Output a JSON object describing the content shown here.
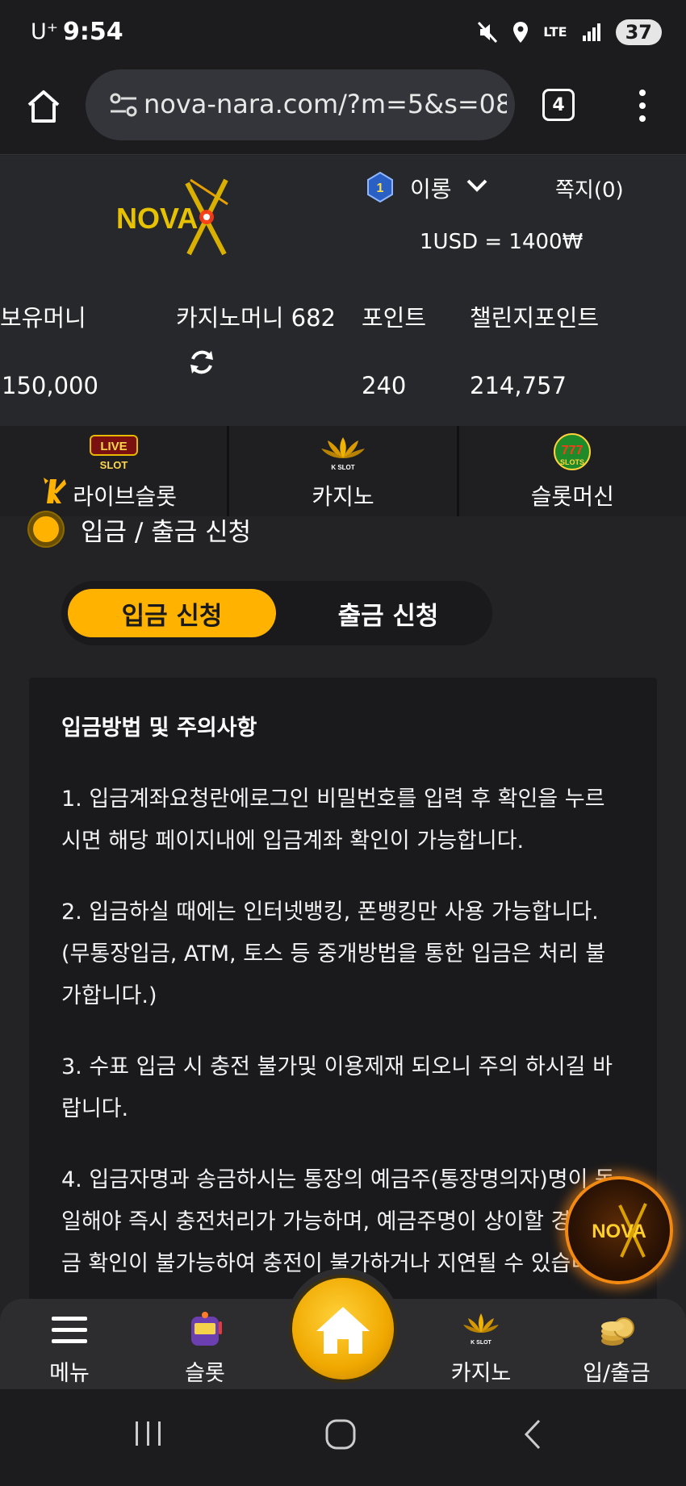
{
  "status_bar": {
    "carrier": "U⁺",
    "time": "9:54",
    "network": "LTE",
    "battery": "37"
  },
  "browser": {
    "url": "nova-nara.com/?m=5&s=08",
    "tab_count": "4"
  },
  "header": {
    "brand": "NOVA",
    "level": "1",
    "username": "이롱",
    "messages_label": "쪽지(0)",
    "exchange_rate": "1USD = 1400₩"
  },
  "balances": {
    "holding_label": "보유머니",
    "holding_value": "150,000",
    "casino_label": "카지노머니 682",
    "point_label": "포인트",
    "point_value": "240",
    "challenge_label": "챌린지포인트",
    "challenge_value": "214,757"
  },
  "game_tabs": [
    {
      "label": "라이브슬롯",
      "icon": "live-slot-icon"
    },
    {
      "label": "카지노",
      "icon": "k-slot-lotus-icon"
    },
    {
      "label": "슬롯머신",
      "icon": "777-slots-icon"
    }
  ],
  "icon_texts": {
    "live": "LIVE",
    "slot": "SLOT",
    "k_slot": "K SLOT",
    "slots": "SLOTS",
    "sevens": "777"
  },
  "section": {
    "title": "입금 / 출금 신청"
  },
  "toggle": {
    "deposit": "입금 신청",
    "withdraw": "출금 신청",
    "selected": "deposit"
  },
  "notice": {
    "title": "입금방법 및 주의사항",
    "items": [
      "1. 입금계좌요청란에로그인 비밀번호를 입력 후 확인을 누르시면 해당 페이지내에 입금계좌 확인이 가능합니다.",
      "2. 입금하실 때에는 인터넷뱅킹, 폰뱅킹만 사용 가능합니다.(무통장입금, ATM, 토스 등 중개방법을 통한 입금은 처리 불가합니다.)",
      "3. 수표 입금 시 충전 불가및 이용제재 되오니 주의 하시길 바랍니다.",
      "4. 입금자명과 송금하시는 통장의 예금주(통장명의자)명이 동일해야 즉시 충전처리가 가능하며, 예금주명이 상이할 경우 입금 확인이 불가능하여 충전이 불가하거나 지연될 수 있습니다."
    ]
  },
  "bottom_nav": {
    "menu": "메뉴",
    "slot": "슬롯",
    "casino": "카지노",
    "banking": "입/출금"
  },
  "colors": {
    "accent": "#ffb300",
    "background": "#232326",
    "panel": "#1a1a1c"
  }
}
